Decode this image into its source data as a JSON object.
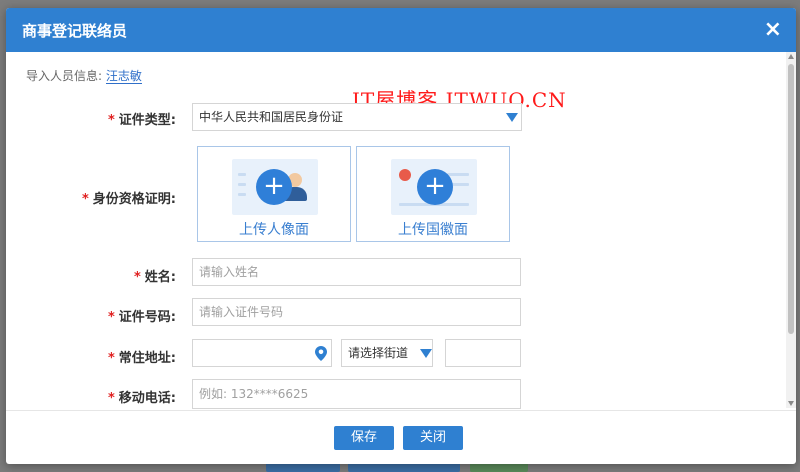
{
  "dialog": {
    "title": "商事登记联络员",
    "close_icon": "close-icon",
    "close_glyph": "×"
  },
  "import_info": {
    "label": "导入人员信息:",
    "name": "汪志敏"
  },
  "watermark": "IT屋博客 ITWUO.CN",
  "form": {
    "required_mark": "*",
    "id_type": {
      "label": "证件类型:",
      "value": "中华人民共和国居民身份证"
    },
    "id_proof": {
      "label": "身份资格证明:",
      "upload_portrait": "上传人像面",
      "upload_emblem": "上传国徽面",
      "plus_glyph": "+"
    },
    "name": {
      "label": "姓名:",
      "placeholder": "请输入姓名"
    },
    "id_number": {
      "label": "证件号码:",
      "placeholder": "请输入证件号码"
    },
    "address": {
      "label": "常住地址:",
      "street_placeholder": "请选择街道"
    },
    "phone": {
      "label": "移动电话:",
      "placeholder": "例如: 132****6625"
    }
  },
  "buttons": {
    "save": "保存",
    "close": "关闭"
  },
  "colors": {
    "header": "#2f80d1",
    "required": "#e02020",
    "link": "#2f6fc9",
    "watermark": "#ff1a1a"
  }
}
